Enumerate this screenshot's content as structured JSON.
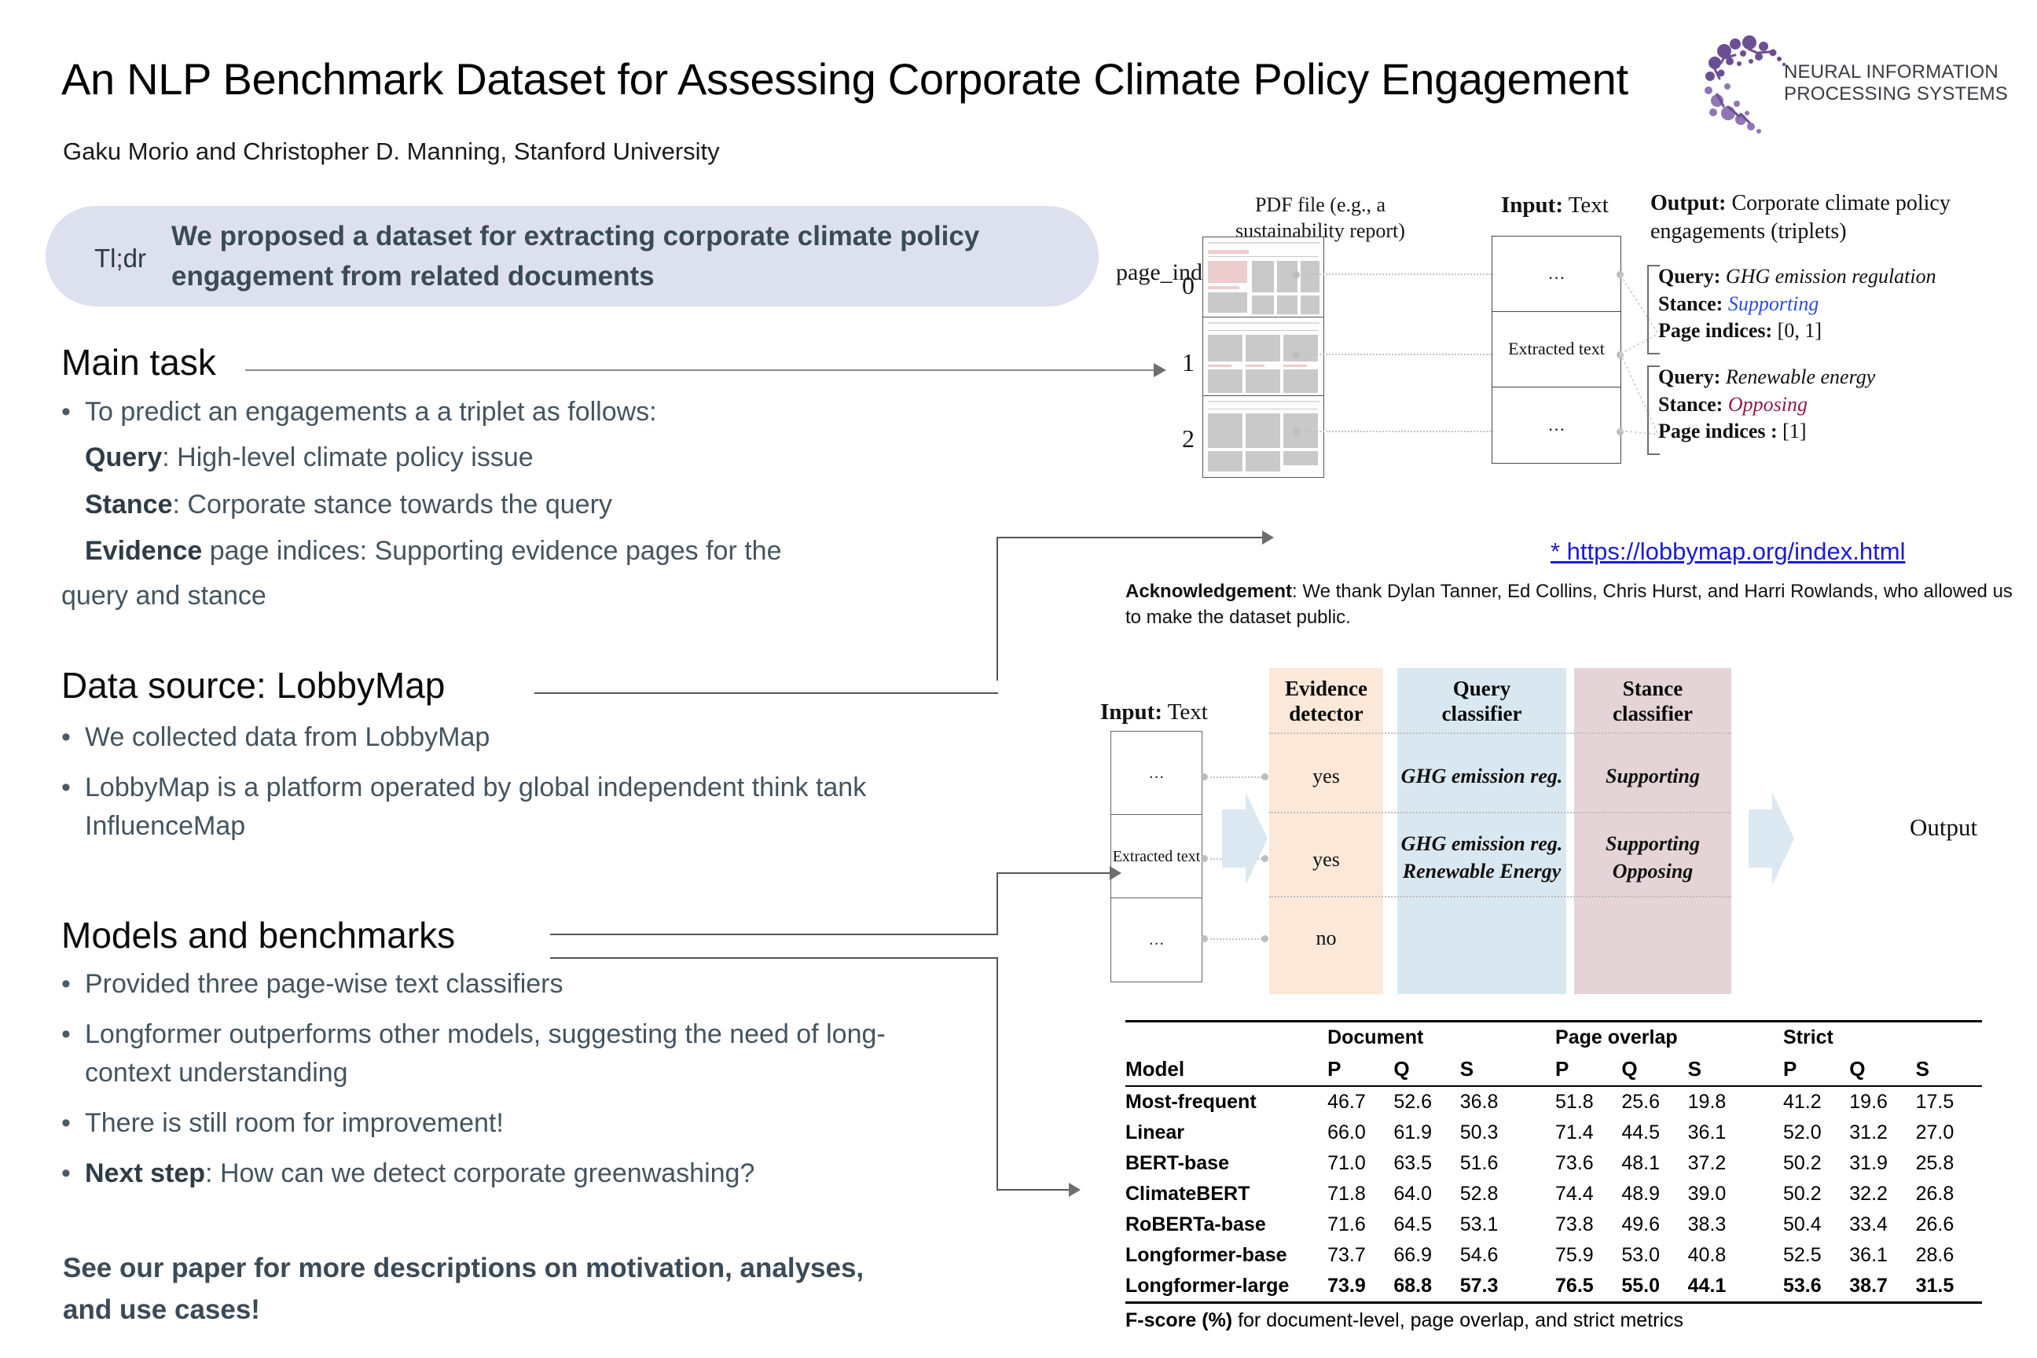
{
  "header": {
    "title": "An NLP Benchmark Dataset for Assessing Corporate Climate Policy Engagement",
    "authors": "Gaku Morio and Christopher D. Manning, Stanford University",
    "logo_line1": "NEURAL INFORMATION",
    "logo_line2": "PROCESSING SYSTEMS"
  },
  "tldr": {
    "label": "Tl;dr",
    "text": "We proposed a dataset for extracting corporate climate policy engagement from related documents"
  },
  "main_task": {
    "heading": "Main task",
    "bullet": "To predict an engagements a a triplet as follows:",
    "query_label": "Query",
    "query_text": ": High-level climate policy issue",
    "stance_label": "Stance",
    "stance_text": ": Corporate stance towards the query",
    "evidence_label": "Evidence",
    "evidence_text": " page indices: Supporting evidence pages for the",
    "evidence_text2": "query and stance"
  },
  "data_source": {
    "heading": "Data source: LobbyMap",
    "bullets": [
      "We collected data from LobbyMap",
      "LobbyMap is a platform operated by global independent think tank InfluenceMap"
    ]
  },
  "models": {
    "heading": "Models and benchmarks",
    "bullets": [
      "Provided three page-wise text classifiers",
      "Longformer outperforms other models, suggesting the need of long-context understanding",
      "There is still room for improvement!"
    ],
    "next_step_label": "Next step",
    "next_step_text": ": How can we detect corporate greenwashing?"
  },
  "closing": {
    "line1": "See our paper for more descriptions on motivation, analyses,",
    "line2": "and use cases!"
  },
  "figure1": {
    "pdf_caption": "PDF file (e.g., a sustainability report)",
    "page_index_label": "page_index:",
    "page_numbers": [
      "0",
      "1",
      "2"
    ],
    "input_caption_bold": "Input:",
    "input_caption_rest": " Text",
    "input_cells": [
      "…",
      "Extracted text",
      "…"
    ],
    "output_caption_bold": "Output:",
    "output_caption_rest": " Corporate climate policy engagements (triplets)",
    "triplets": [
      {
        "query_label": "Query:",
        "query_value": "GHG emission regulation",
        "stance_label": "Stance:",
        "stance_value": "Supporting",
        "stance_color": "#2b4fd4",
        "pages_label": "Page indices:",
        "pages_value": "[0, 1]"
      },
      {
        "query_label": "Query:",
        "query_value": "Renewable energy",
        "stance_label": "Stance:",
        "stance_value": "Opposing",
        "stance_color": "#8d1b53",
        "pages_label": "Page indices :",
        "pages_value": "[1]"
      }
    ]
  },
  "link": {
    "text": "* https://lobbymap.org/index.html",
    "color": "#1b1bd6"
  },
  "acknowledgement": {
    "label": "Acknowledgement",
    "text": ": We thank Dylan Tanner, Ed Collins, Chris Hurst, and Harri Rowlands, who allowed us to make the dataset public."
  },
  "figure2": {
    "input_caption_bold": "Input:",
    "input_caption_rest": " Text",
    "input_cells": [
      "…",
      "Extracted text",
      "…"
    ],
    "columns": [
      {
        "title_line1": "Evidence",
        "title_line2": "detector",
        "bg": "#fbe8d8",
        "cells": [
          "yes",
          "yes",
          "no"
        ]
      },
      {
        "title_line1": "Query",
        "title_line2": "classifier",
        "bg": "#d9e7f0",
        "cells": [
          "GHG emission reg.",
          "GHG emission reg. Renewable Energy",
          ""
        ]
      },
      {
        "title_line1": "Stance",
        "title_line2": "classifier",
        "bg": "#e4d3d7",
        "cells": [
          "Supporting",
          "Supporting Opposing",
          ""
        ]
      }
    ],
    "stance_row1": "Supporting",
    "stance_row2a": "Supporting",
    "stance_row2b": "Opposing",
    "query_row2a": "GHG emission reg.",
    "query_row2b": "Renewable Energy",
    "output_label": "Output"
  },
  "table_data": {
    "type": "table",
    "caption_bold": "F-score (%)",
    "caption_rest": " for document-level, page overlap, and strict metrics",
    "group_headers": [
      "",
      "Document",
      "Page overlap",
      "Strict"
    ],
    "model_header": "Model",
    "sub_headers": [
      "P",
      "Q",
      "S",
      "P",
      "Q",
      "S",
      "P",
      "Q",
      "S"
    ],
    "rows": [
      {
        "model": "Most-frequent",
        "values": [
          "46.7",
          "52.6",
          "36.8",
          "51.8",
          "25.6",
          "19.8",
          "41.2",
          "19.6",
          "17.5"
        ],
        "best": false
      },
      {
        "model": "Linear",
        "values": [
          "66.0",
          "61.9",
          "50.3",
          "71.4",
          "44.5",
          "36.1",
          "52.0",
          "31.2",
          "27.0"
        ],
        "best": false
      },
      {
        "model": "BERT-base",
        "values": [
          "71.0",
          "63.5",
          "51.6",
          "73.6",
          "48.1",
          "37.2",
          "50.2",
          "31.9",
          "25.8"
        ],
        "best": false
      },
      {
        "model": "ClimateBERT",
        "values": [
          "71.8",
          "64.0",
          "52.8",
          "74.4",
          "48.9",
          "39.0",
          "50.2",
          "32.2",
          "26.8"
        ],
        "best": false
      },
      {
        "model": "RoBERTa-base",
        "values": [
          "71.6",
          "64.5",
          "53.1",
          "73.8",
          "49.6",
          "38.3",
          "50.4",
          "33.4",
          "26.6"
        ],
        "best": false
      },
      {
        "model": "Longformer-base",
        "values": [
          "73.7",
          "66.9",
          "54.6",
          "75.9",
          "53.0",
          "40.8",
          "52.5",
          "36.1",
          "28.6"
        ],
        "best": false
      },
      {
        "model": "Longformer-large",
        "values": [
          "73.9",
          "68.8",
          "57.3",
          "76.5",
          "55.0",
          "44.1",
          "53.6",
          "38.7",
          "31.5"
        ],
        "best": true
      }
    ]
  }
}
